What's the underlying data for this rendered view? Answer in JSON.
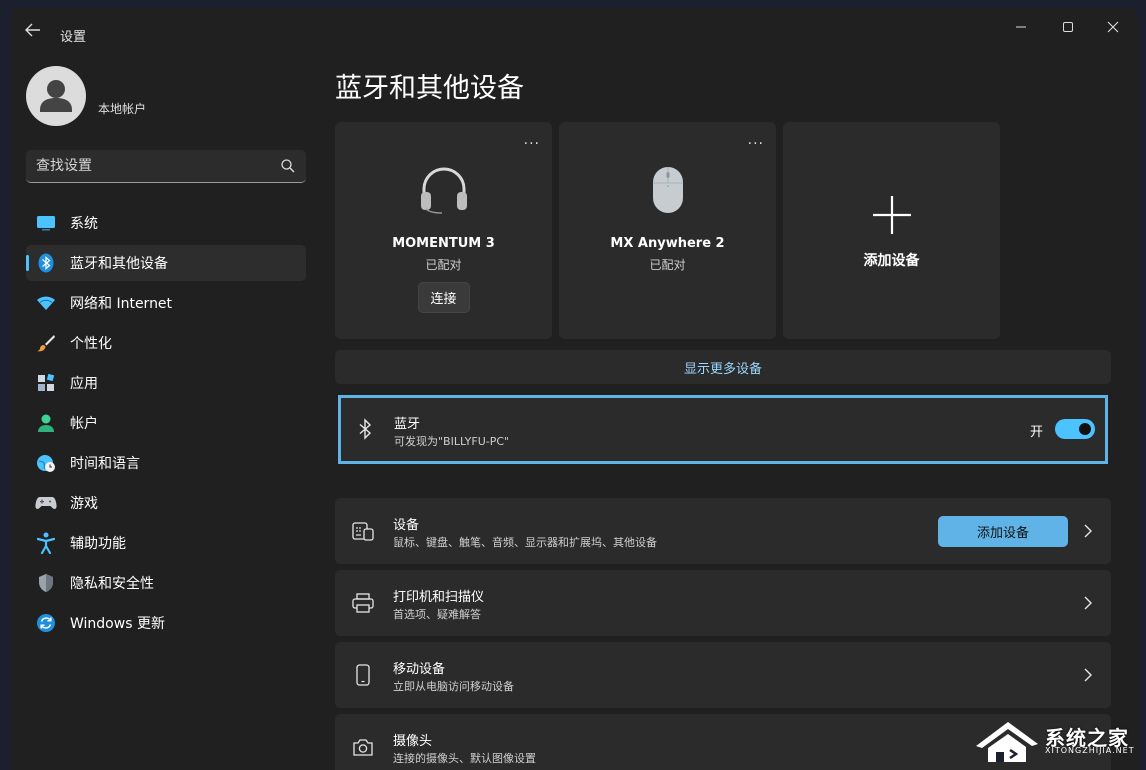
{
  "window": {
    "title": "设置"
  },
  "account": {
    "name": "",
    "type": "本地帐户"
  },
  "search": {
    "placeholder": "查找设置"
  },
  "nav": [
    {
      "label": "系统",
      "icon": "monitor-icon"
    },
    {
      "label": "蓝牙和其他设备",
      "icon": "bluetooth-icon",
      "active": true
    },
    {
      "label": "网络和 Internet",
      "icon": "wifi-icon"
    },
    {
      "label": "个性化",
      "icon": "paintbrush-icon"
    },
    {
      "label": "应用",
      "icon": "apps-icon"
    },
    {
      "label": "帐户",
      "icon": "person-icon"
    },
    {
      "label": "时间和语言",
      "icon": "globe-clock-icon"
    },
    {
      "label": "游戏",
      "icon": "gamepad-icon"
    },
    {
      "label": "辅助功能",
      "icon": "accessibility-icon"
    },
    {
      "label": "隐私和安全性",
      "icon": "shield-icon"
    },
    {
      "label": "Windows 更新",
      "icon": "update-icon"
    }
  ],
  "page": {
    "title": "蓝牙和其他设备"
  },
  "devices": [
    {
      "name": "MOMENTUM 3",
      "status": "已配对",
      "action": "连接",
      "more": "...",
      "icon": "headphones-icon"
    },
    {
      "name": "MX Anywhere 2",
      "status": "已配对",
      "more": "...",
      "icon": "mouse-icon"
    }
  ],
  "add_card": {
    "label": "添加设备"
  },
  "show_more": "显示更多设备",
  "bluetooth": {
    "title": "蓝牙",
    "subtitle": "可发现为\"BILLYFU-PC\"",
    "state": "开",
    "on": true
  },
  "rows": [
    {
      "title": "设备",
      "subtitle": "鼠标、键盘、触笔、音频、显示器和扩展坞、其他设备",
      "button": "添加设备",
      "icon": "keyboard-device-icon"
    },
    {
      "title": "打印机和扫描仪",
      "subtitle": "首选项、疑难解答",
      "icon": "printer-icon"
    },
    {
      "title": "移动设备",
      "subtitle": "立即从电脑访问移动设备",
      "icon": "phone-icon"
    },
    {
      "title": "摄像头",
      "subtitle": "连接的摄像头、默认图像设置",
      "icon": "camera-icon"
    }
  ],
  "watermark": {
    "text": "系统之家",
    "sub": "XITONGZHIJIA.NET"
  },
  "colors": {
    "accent": "#4cc2ff",
    "highlight": "#60b3e6",
    "bg": "#202020",
    "card": "#2b2b2b"
  }
}
